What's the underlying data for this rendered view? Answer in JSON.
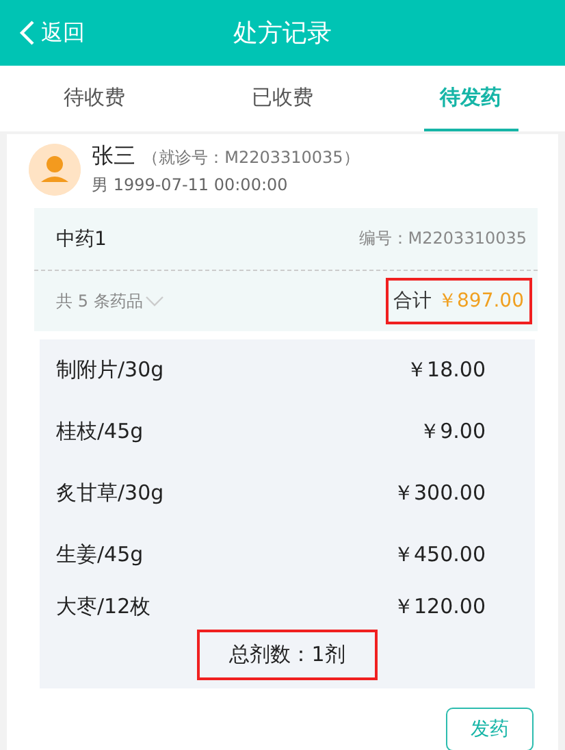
{
  "header": {
    "back": "返回",
    "title": "处方记录"
  },
  "tabs": [
    {
      "label": "待收费",
      "selected": false
    },
    {
      "label": "已收费",
      "selected": false
    },
    {
      "label": "待发药",
      "selected": true
    }
  ],
  "patient": {
    "name": "张三",
    "visit_no": "（就诊号：M2203310035）",
    "info": "男 1999-07-11 00:00:00"
  },
  "prescription": {
    "name": "中药1",
    "number": "编号：M2203310035",
    "count": "共 5 条药品",
    "total_label": "合计",
    "total": "￥897.00",
    "total_highlighted": true
  },
  "drugs": [
    {
      "name": "制附片/30g",
      "price": "￥18.00"
    },
    {
      "name": "桂枝/45g",
      "price": "￥9.00"
    },
    {
      "name": "炙甘草/30g",
      "price": "￥300.00"
    },
    {
      "name": "生姜/45g",
      "price": "￥450.00"
    },
    {
      "name": "大枣/12枚",
      "price": "￥120.00"
    }
  ],
  "dose": {
    "text": "总剂数：1剂",
    "highlighted": true
  },
  "action": "发药"
}
